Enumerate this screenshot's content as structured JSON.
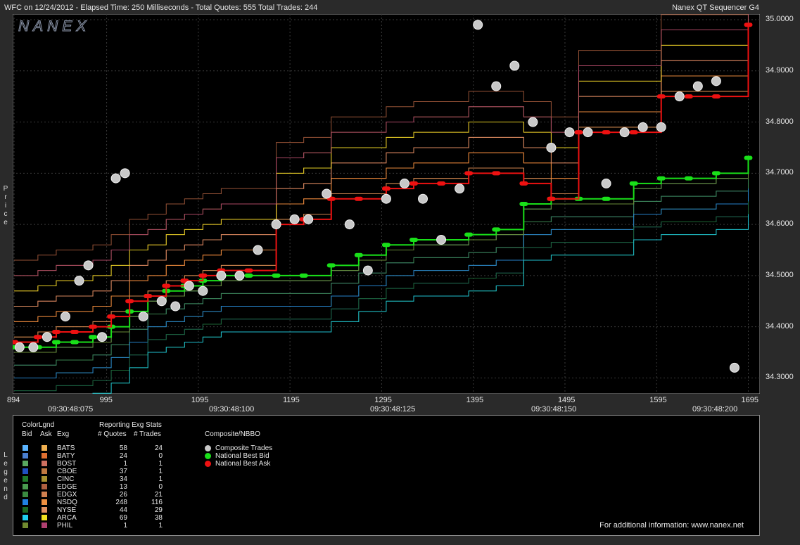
{
  "header": {
    "title": "WFC on 12/24/2012  -  Elapsed Time: 250 Milliseconds  -  Total Quotes: 555  Total Trades: 244",
    "right": "Nanex QT Sequencer G4"
  },
  "brand": "NANEX",
  "side_labels": {
    "price": "Price",
    "legend": "Legend"
  },
  "colors": {
    "plot_bg": "#000000",
    "grid": "#3a3a3a",
    "best_bid": "#19e019",
    "best_ask": "#ee1111",
    "trade_fill": "#c8c8c8",
    "trade_edge": "#f0f0f0"
  },
  "chart_data": {
    "type": "line",
    "ylim": [
      34.28,
      35.0
    ],
    "xlim": [
      894,
      1700
    ],
    "grid": true,
    "x_ticks": [
      "894",
      "995",
      "1095",
      "1195",
      "1295",
      "1395",
      "1495",
      "1595",
      "1695"
    ],
    "x_time_labels": [
      "09:30:48:075",
      "09:30:48:100",
      "09:30:48:125",
      "09:30:48:150",
      "09:30:48:200"
    ],
    "y_ticks": [
      "35.0000",
      "34.9000",
      "34.8000",
      "34.7000",
      "34.6000",
      "34.5000",
      "34.4000",
      "34.3000"
    ],
    "series": [
      {
        "name": "National Best Bid",
        "x": [
          894,
          920,
          940,
          960,
          980,
          1000,
          1020,
          1040,
          1060,
          1080,
          1100,
          1120,
          1150,
          1180,
          1210,
          1240,
          1270,
          1300,
          1330,
          1360,
          1390,
          1420,
          1450,
          1480,
          1510,
          1540,
          1570,
          1600,
          1630,
          1660,
          1695
        ],
        "y": [
          34.36,
          34.36,
          34.37,
          34.37,
          34.38,
          34.4,
          34.43,
          34.46,
          34.47,
          34.48,
          34.49,
          34.5,
          34.5,
          34.5,
          34.5,
          34.52,
          34.54,
          34.56,
          34.57,
          34.57,
          34.58,
          34.59,
          34.64,
          34.65,
          34.65,
          34.65,
          34.68,
          34.69,
          34.69,
          34.7,
          34.73
        ]
      },
      {
        "name": "National Best Ask",
        "x": [
          894,
          920,
          940,
          960,
          980,
          1000,
          1020,
          1040,
          1060,
          1080,
          1100,
          1120,
          1150,
          1180,
          1210,
          1240,
          1270,
          1300,
          1330,
          1360,
          1390,
          1420,
          1450,
          1480,
          1510,
          1540,
          1570,
          1600,
          1630,
          1660,
          1695
        ],
        "y": [
          34.37,
          34.38,
          34.39,
          34.39,
          34.4,
          34.42,
          34.45,
          34.46,
          34.48,
          34.49,
          34.5,
          34.51,
          34.51,
          34.6,
          34.61,
          34.65,
          34.65,
          34.67,
          34.68,
          34.68,
          34.7,
          34.7,
          34.68,
          34.65,
          34.78,
          34.78,
          34.78,
          34.85,
          34.85,
          34.85,
          34.99
        ]
      },
      {
        "name": "Composite Trades",
        "x": [
          900,
          915,
          930,
          950,
          965,
          975,
          990,
          1005,
          1015,
          1035,
          1055,
          1070,
          1085,
          1100,
          1120,
          1140,
          1160,
          1180,
          1200,
          1215,
          1235,
          1260,
          1280,
          1300,
          1320,
          1340,
          1360,
          1380,
          1400,
          1420,
          1440,
          1460,
          1480,
          1500,
          1520,
          1540,
          1560,
          1580,
          1600,
          1620,
          1640,
          1660,
          1680
        ],
        "y": [
          34.36,
          34.36,
          34.38,
          34.42,
          34.49,
          34.52,
          34.38,
          34.69,
          34.7,
          34.42,
          34.45,
          34.44,
          34.48,
          34.47,
          34.5,
          34.5,
          34.55,
          34.6,
          34.61,
          34.61,
          34.66,
          34.6,
          34.51,
          34.65,
          34.68,
          34.65,
          34.57,
          34.67,
          34.99,
          34.87,
          34.91,
          34.8,
          34.75,
          34.78,
          34.78,
          34.68,
          34.78,
          34.79,
          34.79,
          34.85,
          34.87,
          34.88,
          34.32
        ]
      }
    ]
  },
  "legend": {
    "color_legend_title": "ColorLgnd",
    "col_bid": "Bid",
    "col_ask": "Ask",
    "col_exg": "Exg",
    "stats_title": "Reporting Exg Stats",
    "col_quotes": "# Quotes",
    "col_trades": "# Trades",
    "composite_title": "Composite/NBBO",
    "exchanges": [
      {
        "exg": "BATS",
        "quotes": "58",
        "trades": "24",
        "bid_color": "#5ab4ff",
        "ask_color": "#f0b050"
      },
      {
        "exg": "BATY",
        "quotes": "24",
        "trades": "0",
        "bid_color": "#4a7fd0",
        "ask_color": "#e07030"
      },
      {
        "exg": "BOST",
        "quotes": "1",
        "trades": "1",
        "bid_color": "#5aa860",
        "ask_color": "#d07060"
      },
      {
        "exg": "CBOE",
        "quotes": "37",
        "trades": "1",
        "bid_color": "#2050c0",
        "ask_color": "#c07840"
      },
      {
        "exg": "CINC",
        "quotes": "34",
        "trades": "1",
        "bid_color": "#207a2a",
        "ask_color": "#a89030"
      },
      {
        "exg": "EDGE",
        "quotes": "13",
        "trades": "0",
        "bid_color": "#4a9a50",
        "ask_color": "#b06040"
      },
      {
        "exg": "EDGX",
        "quotes": "26",
        "trades": "21",
        "bid_color": "#3a8a40",
        "ask_color": "#d08050"
      },
      {
        "exg": "NSDQ",
        "quotes": "248",
        "trades": "116",
        "bid_color": "#2080e0",
        "ask_color": "#f09040"
      },
      {
        "exg": "NYSE",
        "quotes": "44",
        "trades": "29",
        "bid_color": "#1c6a20",
        "ask_color": "#e09060"
      },
      {
        "exg": "ARCA",
        "quotes": "69",
        "trades": "38",
        "bid_color": "#20d0f0",
        "ask_color": "#f0e020"
      },
      {
        "exg": "PHIL",
        "quotes": "1",
        "trades": "1",
        "bid_color": "#708a30",
        "ask_color": "#b04070"
      }
    ],
    "keys": [
      {
        "label": "Composite Trades",
        "color": "#c8c8c8"
      },
      {
        "label": "National Best Bid",
        "color": "#19e019"
      },
      {
        "label": "National Best Ask",
        "color": "#ee1111"
      }
    ]
  },
  "footer": "For additional information: www.nanex.net"
}
